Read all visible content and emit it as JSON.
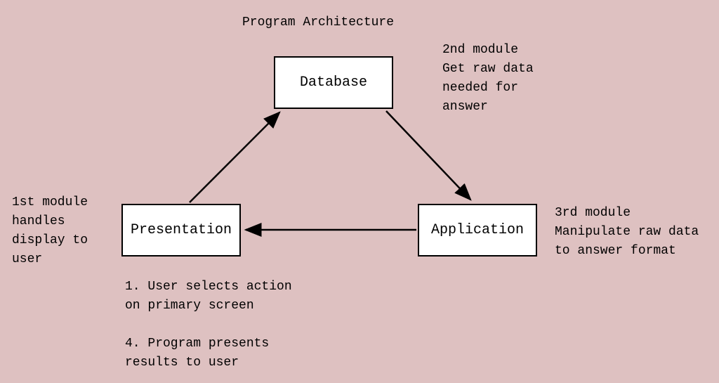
{
  "title": "Program Architecture",
  "boxes": {
    "database": "Database",
    "presentation": "Presentation",
    "application": "Application"
  },
  "annotations": {
    "second_module": "2nd module\nGet raw data\nneeded for\nanswer",
    "first_module": "1st module\nhandles\ndisplay to\nuser",
    "third_module": "3rd module\nManipulate raw data\nto answer format",
    "bottom": "1. User selects action\non primary screen\n\n4. Program presents\nresults to user"
  },
  "colors": {
    "background": "#dec1c1",
    "box_fill": "#ffffff",
    "stroke": "#000000"
  }
}
